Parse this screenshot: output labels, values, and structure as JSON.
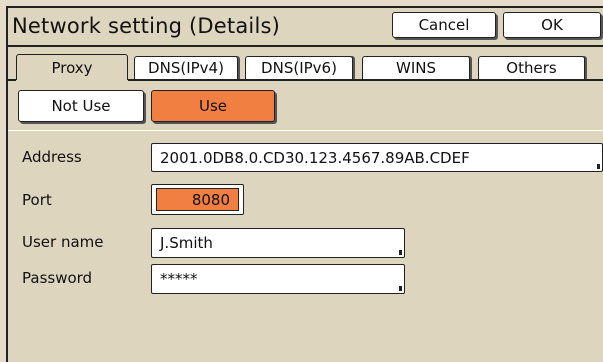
{
  "window": {
    "title": "Network setting (Details)"
  },
  "header_buttons": {
    "cancel": "Cancel",
    "ok": "OK"
  },
  "tabs": [
    {
      "label": "Proxy",
      "active": true
    },
    {
      "label": "DNS(IPv4)",
      "active": false
    },
    {
      "label": "DNS(IPv6)",
      "active": false
    },
    {
      "label": "WINS",
      "active": false
    },
    {
      "label": "Others",
      "active": false
    }
  ],
  "proxy_mode": {
    "not_use": "Not Use",
    "use": "Use",
    "selected": "Use"
  },
  "form": {
    "address": {
      "label": "Address",
      "value": "2001.0DB8.0.CD30.123.4567.89AB.CDEF"
    },
    "port": {
      "label": "Port",
      "value": "8080"
    },
    "user_name": {
      "label": "User name",
      "value": "J.Smith"
    },
    "password": {
      "label": "Password",
      "value": "*****"
    }
  },
  "colors": {
    "background": "#ded5bf",
    "selected": "#f07f41",
    "border": "#222222"
  }
}
